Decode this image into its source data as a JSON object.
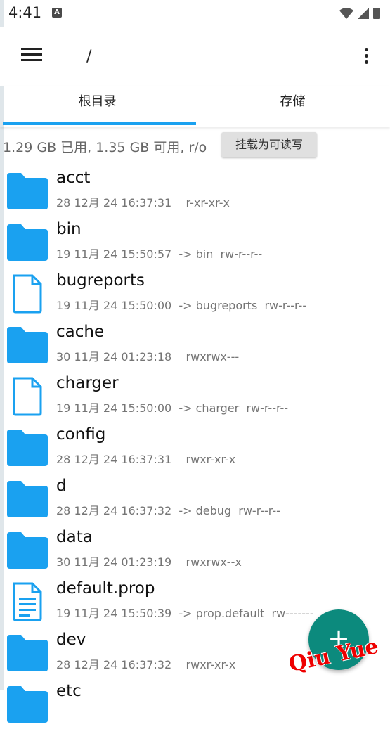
{
  "status_bar": {
    "time": "4:41",
    "notif_icon": "A"
  },
  "app_bar": {
    "path": "/",
    "menu_icon": "hamburger-menu-icon",
    "more_icon": "more-vert-icon"
  },
  "tabs": [
    {
      "label": "根目录",
      "selected": true
    },
    {
      "label": "存储",
      "selected": false
    }
  ],
  "storage": {
    "text": "1.29 GB 已用, 1.35 GB 可用, r/o",
    "button": "挂载为可读写"
  },
  "files": [
    {
      "name": "acct",
      "meta": "28 12月 24 16:37:31    r-xr-xr-x",
      "icon": "folder-icon"
    },
    {
      "name": "bin",
      "meta": "19 11月 24 15:50:57  -> bin  rw-r--r--",
      "icon": "folder-icon"
    },
    {
      "name": "bugreports",
      "meta": "19 11月 24 15:50:00  -> bugreports  rw-r--r--",
      "icon": "file-icon"
    },
    {
      "name": "cache",
      "meta": "30 11月 24 01:23:18    rwxrwx---",
      "icon": "folder-icon"
    },
    {
      "name": "charger",
      "meta": "19 11月 24 15:50:00  -> charger  rw-r--r--",
      "icon": "file-icon"
    },
    {
      "name": "config",
      "meta": "28 12月 24 16:37:31    rwxr-xr-x",
      "icon": "folder-icon"
    },
    {
      "name": "d",
      "meta": "28 12月 24 16:37:32  -> debug  rw-r--r--",
      "icon": "folder-icon"
    },
    {
      "name": "data",
      "meta": "30 11月 24 01:23:19    rwxrwx--x",
      "icon": "folder-icon"
    },
    {
      "name": "default.prop",
      "meta": "19 11月 24 15:50:39  -> prop.default  rw-------",
      "icon": "text-file-icon"
    },
    {
      "name": "dev",
      "meta": "28 12月 24 16:37:32    rwxr-xr-x",
      "icon": "folder-icon"
    },
    {
      "name": "etc",
      "meta": "",
      "icon": "folder-icon"
    }
  ],
  "fab": {
    "icon": "plus-icon",
    "label": "+"
  },
  "watermark": "Qiu Yue",
  "colors": {
    "accent": "#1aa1f0",
    "folder": "#1aa1f0",
    "fab": "#0c8a7d",
    "watermark": "#e00000"
  }
}
